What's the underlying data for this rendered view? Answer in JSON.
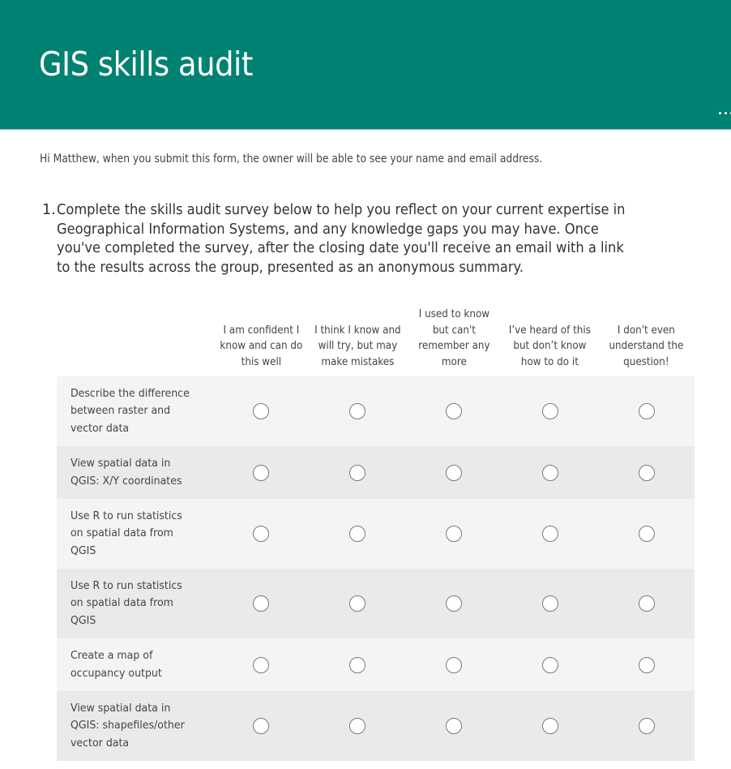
{
  "header": {
    "title": "GIS skills audit",
    "more_icon": "ellipsis-icon",
    "color": "#008272"
  },
  "notice": "Hi Matthew, when you submit this form, the owner will be able to see your name and email address.",
  "question": {
    "number": "1.",
    "text": "Complete the skills audit survey below to help you reflect on your current expertise in Geographical Information Systems, and any knowledge gaps you may have.  Once you've completed the survey, after the closing date you'll receive an email with a link to the results across the group, presented as an anonymous summary."
  },
  "matrix": {
    "columns": [
      "I am confident I know and can do this well",
      "I think I know and will try, but may make mistakes",
      "I used to know but can't remember any more",
      "I’ve heard of this but don’t know how to do it",
      "I don't even understand the question!"
    ],
    "rows": [
      {
        "label": "Describe the difference between raster and vector data",
        "selected": null
      },
      {
        "label": "View spatial data in QGIS: X/Y coordinates",
        "selected": null
      },
      {
        "label": "Use R to run statistics on spatial data from QGIS",
        "selected": null
      },
      {
        "label": "Use R to run statistics on spatial data from QGIS",
        "selected": null
      },
      {
        "label": "Create a map of occupancy output",
        "selected": null
      },
      {
        "label": "View spatial data in QGIS: shapefiles/other vector data",
        "selected": null
      }
    ]
  }
}
